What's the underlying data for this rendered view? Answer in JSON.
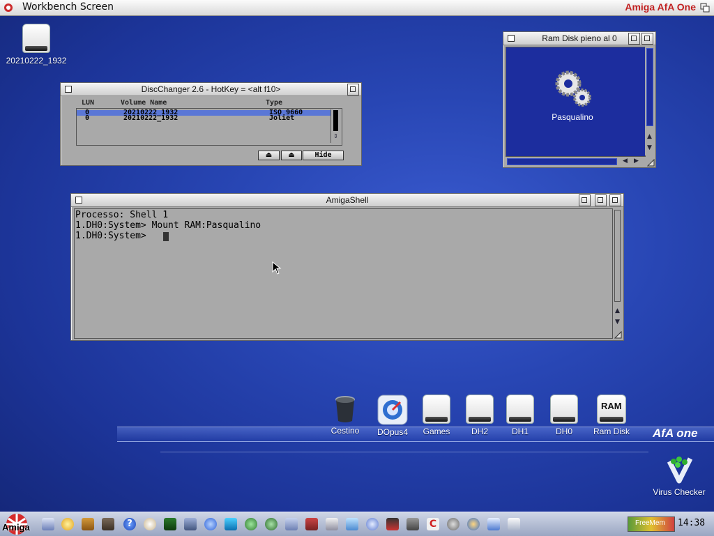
{
  "screen": {
    "title": "Workbench Screen",
    "logo": "Amiga AfA One"
  },
  "desktop_icons": [
    {
      "label": "20210222_1932"
    },
    {
      "label": "Virus Checker"
    }
  ],
  "ramdisk_window": {
    "title": "Ram Disk  pieno al 0",
    "icon_label": "Pasqualino"
  },
  "discchanger": {
    "title": "DiscChanger 2.6  -  HotKey = <alt f10>",
    "headers": {
      "lun": "LUN",
      "volume": "Volume Name",
      "type": "Type"
    },
    "rows": [
      {
        "lun": "0",
        "volume": "20210222_1932",
        "type": "ISO 9660"
      },
      {
        "lun": "0",
        "volume": "20210222_1932",
        "type": "Joliet"
      }
    ],
    "hide_label": "Hide"
  },
  "shell": {
    "title": "AmigaShell",
    "lines": [
      "Processo: Shell 1",
      "1.DH0:System> Mount RAM:Pasqualino",
      "1.DH0:System> "
    ]
  },
  "dock": {
    "items": [
      {
        "label": "Cestino",
        "icon": "trash-icon"
      },
      {
        "label": "DOpus4",
        "icon": "dopus-icon"
      },
      {
        "label": "Games",
        "icon": "drive-icon"
      },
      {
        "label": "DH2",
        "icon": "drive-icon"
      },
      {
        "label": "DH1",
        "icon": "drive-icon"
      },
      {
        "label": "DH0",
        "icon": "drive-icon"
      },
      {
        "label": "Ram Disk",
        "icon": "ram-icon"
      }
    ],
    "brand": "AfA one",
    "ram_text": "RAM"
  },
  "taskbar": {
    "start_label": "Amiga",
    "freemem_label": "FreeMem",
    "clock": "14:38"
  }
}
